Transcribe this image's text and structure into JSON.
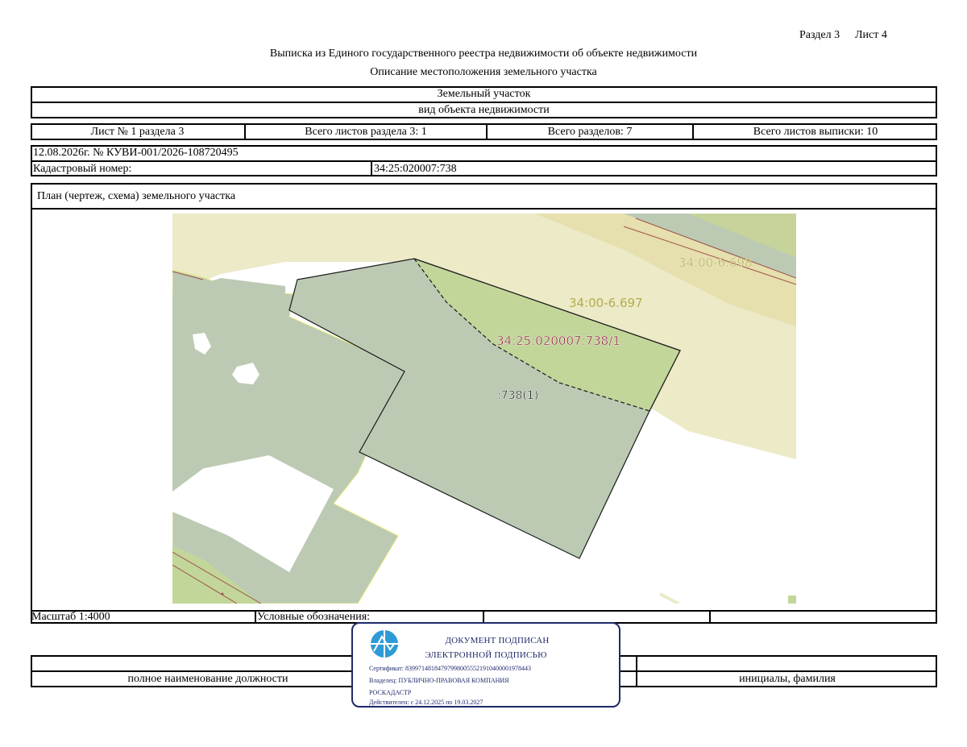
{
  "header": {
    "section": "Раздел 3",
    "sheet": "Лист 4",
    "title": "Выписка из Единого государственного реестра недвижимости об объекте недвижимости",
    "subtitle": "Описание местоположения земельного участка"
  },
  "object": {
    "type": "Земельный участок",
    "type_caption": "вид объекта недвижимости"
  },
  "sheets": {
    "sheet_no": "Лист № 1 раздела 3",
    "total_section_sheets": "Всего листов раздела 3: 1",
    "total_sections": "Всего разделов: 7",
    "total_extract_sheets": "Всего листов выписки: 10"
  },
  "record": {
    "date_number": "12.08.2026г. № КУВИ-001/2026-108720495",
    "cadastral_label": "Кадастровый номер:",
    "cadastral_value": "34:25:020007:738"
  },
  "plan": {
    "title": "План (чертеж, схема) земельного участка",
    "labels": {
      "zone_698": "34:00-6.698",
      "zone_697": "34:00-6.697",
      "part_label": "34:25:020007:738/1",
      "parcel_label": ":738(1)"
    },
    "colors": {
      "parcel_fill": "#bccab4",
      "part_fill": "#c2d69a",
      "zone_fill": "#eceac7",
      "zone_strip": "#e6dfae",
      "boundary": "#1a1a1a",
      "part_label_color": "#8b1a2e",
      "zone_label_color": "#b3ad4e"
    }
  },
  "footer": {
    "scale": "Масштаб 1:4000",
    "legend_label": "Условные обозначения:",
    "position_caption": "полное наименование должности",
    "name_caption": "инициалы, фамилия"
  },
  "stamp": {
    "line1": "ДОКУМЕНТ ПОДПИСАН",
    "line2": "ЭЛЕКТРОННОЙ ПОДПИСЬЮ",
    "certificate": "Сертификат: 839971481847979980055521910400001978443",
    "owner_line1": "Владелец: ПУБЛИЧНО-ПРАВОВАЯ КОМПАНИЯ",
    "owner_line2": "РОСКАДАСТР",
    "validity": "Действителен: с 24.12.2025 по 19.03.2027",
    "icon": "rosreestr-emblem-icon",
    "color": "#1f2a6b"
  }
}
